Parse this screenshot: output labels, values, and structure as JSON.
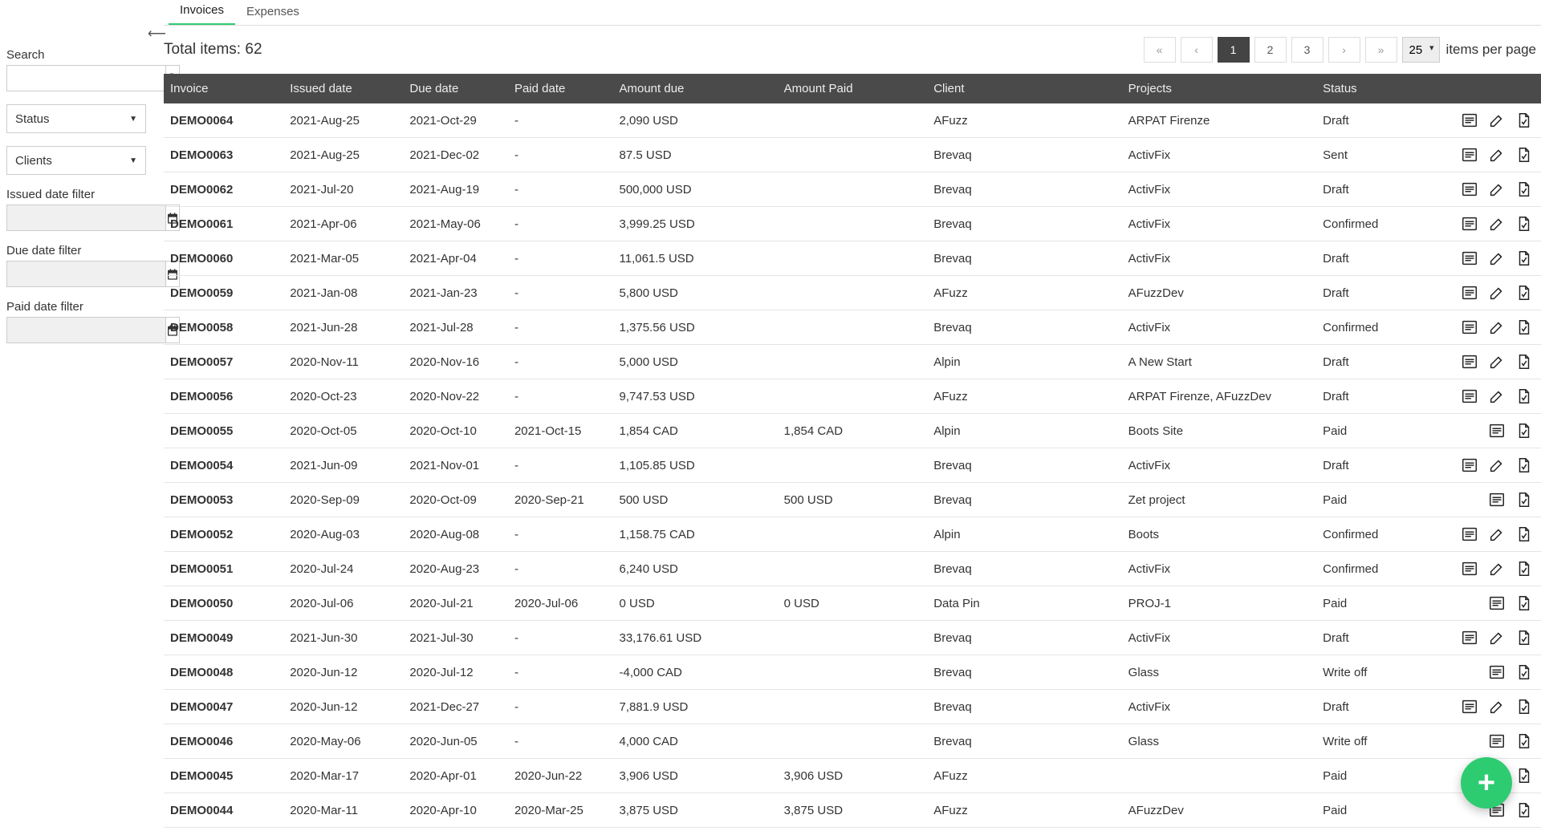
{
  "tabs": {
    "invoices": "Invoices",
    "expenses": "Expenses"
  },
  "sidebar": {
    "search_label": "Search",
    "status_label": "Status",
    "clients_label": "Clients",
    "issued_label": "Issued date filter",
    "due_label": "Due date filter",
    "paid_label": "Paid date filter"
  },
  "summary": {
    "total_prefix": "Total items: ",
    "total_count": "62"
  },
  "pager": {
    "first": "«",
    "prev": "‹",
    "next": "›",
    "last": "»",
    "pages": [
      "1",
      "2",
      "3"
    ],
    "active": "1",
    "per_page_value": "25",
    "per_page_label": "items per page"
  },
  "columns": {
    "invoice": "Invoice",
    "issued": "Issued date",
    "due": "Due date",
    "paid": "Paid date",
    "amount_due": "Amount due",
    "amount_paid": "Amount Paid",
    "client": "Client",
    "projects": "Projects",
    "status": "Status"
  },
  "rows": [
    {
      "inv": "DEMO0064",
      "iss": "2021-Aug-25",
      "due": "2021-Oct-29",
      "paid": "-",
      "adue": "2,090 USD",
      "apaid": "",
      "client": "AFuzz",
      "proj": "ARPAT Firenze",
      "status": "Draft",
      "act": "vep"
    },
    {
      "inv": "DEMO0063",
      "iss": "2021-Aug-25",
      "due": "2021-Dec-02",
      "paid": "-",
      "adue": "87.5 USD",
      "apaid": "",
      "client": "Brevaq",
      "proj": "ActivFix",
      "status": "Sent",
      "act": "vep"
    },
    {
      "inv": "DEMO0062",
      "iss": "2021-Jul-20",
      "due": "2021-Aug-19",
      "paid": "-",
      "adue": "500,000 USD",
      "apaid": "",
      "client": "Brevaq",
      "proj": "ActivFix",
      "status": "Draft",
      "act": "vep"
    },
    {
      "inv": "DEMO0061",
      "iss": "2021-Apr-06",
      "due": "2021-May-06",
      "paid": "-",
      "adue": "3,999.25 USD",
      "apaid": "",
      "client": "Brevaq",
      "proj": "ActivFix",
      "status": "Confirmed",
      "act": "vep"
    },
    {
      "inv": "DEMO0060",
      "iss": "2021-Mar-05",
      "due": "2021-Apr-04",
      "paid": "-",
      "adue": "11,061.5 USD",
      "apaid": "",
      "client": "Brevaq",
      "proj": "ActivFix",
      "status": "Draft",
      "act": "vep"
    },
    {
      "inv": "DEMO0059",
      "iss": "2021-Jan-08",
      "due": "2021-Jan-23",
      "paid": "-",
      "adue": "5,800 USD",
      "apaid": "",
      "client": "AFuzz",
      "proj": "AFuzzDev",
      "status": "Draft",
      "act": "vep"
    },
    {
      "inv": "DEMO0058",
      "iss": "2021-Jun-28",
      "due": "2021-Jul-28",
      "paid": "-",
      "adue": "1,375.56 USD",
      "apaid": "",
      "client": "Brevaq",
      "proj": "ActivFix",
      "status": "Confirmed",
      "act": "vep"
    },
    {
      "inv": "DEMO0057",
      "iss": "2020-Nov-11",
      "due": "2020-Nov-16",
      "paid": "-",
      "adue": "5,000 USD",
      "apaid": "",
      "client": "Alpin",
      "proj": "A New Start",
      "status": "Draft",
      "act": "vep"
    },
    {
      "inv": "DEMO0056",
      "iss": "2020-Oct-23",
      "due": "2020-Nov-22",
      "paid": "-",
      "adue": "9,747.53 USD",
      "apaid": "",
      "client": "AFuzz",
      "proj": "ARPAT Firenze, AFuzzDev",
      "status": "Draft",
      "act": "vep"
    },
    {
      "inv": "DEMO0055",
      "iss": "2020-Oct-05",
      "due": "2020-Oct-10",
      "paid": "2021-Oct-15",
      "adue": "1,854 CAD",
      "apaid": "1,854 CAD",
      "client": "Alpin",
      "proj": "Boots Site",
      "status": "Paid",
      "act": "vp"
    },
    {
      "inv": "DEMO0054",
      "iss": "2021-Jun-09",
      "due": "2021-Nov-01",
      "paid": "-",
      "adue": "1,105.85 USD",
      "apaid": "",
      "client": "Brevaq",
      "proj": "ActivFix",
      "status": "Draft",
      "act": "vep"
    },
    {
      "inv": "DEMO0053",
      "iss": "2020-Sep-09",
      "due": "2020-Oct-09",
      "paid": "2020-Sep-21",
      "adue": "500 USD",
      "apaid": "500 USD",
      "client": "Brevaq",
      "proj": "Zet project",
      "status": "Paid",
      "act": "vp"
    },
    {
      "inv": "DEMO0052",
      "iss": "2020-Aug-03",
      "due": "2020-Aug-08",
      "paid": "-",
      "adue": "1,158.75 CAD",
      "apaid": "",
      "client": "Alpin",
      "proj": "Boots",
      "status": "Confirmed",
      "act": "vep"
    },
    {
      "inv": "DEMO0051",
      "iss": "2020-Jul-24",
      "due": "2020-Aug-23",
      "paid": "-",
      "adue": "6,240 USD",
      "apaid": "",
      "client": "Brevaq",
      "proj": "ActivFix",
      "status": "Confirmed",
      "act": "vep"
    },
    {
      "inv": "DEMO0050",
      "iss": "2020-Jul-06",
      "due": "2020-Jul-21",
      "paid": "2020-Jul-06",
      "adue": "0 USD",
      "apaid": "0 USD",
      "client": "Data Pin",
      "proj": "PROJ-1",
      "status": "Paid",
      "act": "vp"
    },
    {
      "inv": "DEMO0049",
      "iss": "2021-Jun-30",
      "due": "2021-Jul-30",
      "paid": "-",
      "adue": "33,176.61 USD",
      "apaid": "",
      "client": "Brevaq",
      "proj": "ActivFix",
      "status": "Draft",
      "act": "vep"
    },
    {
      "inv": "DEMO0048",
      "iss": "2020-Jun-12",
      "due": "2020-Jul-12",
      "paid": "-",
      "adue": "-4,000 CAD",
      "apaid": "",
      "client": "Brevaq",
      "proj": "Glass",
      "status": "Write off",
      "act": "vp"
    },
    {
      "inv": "DEMO0047",
      "iss": "2020-Jun-12",
      "due": "2021-Dec-27",
      "paid": "-",
      "adue": "7,881.9 USD",
      "apaid": "",
      "client": "Brevaq",
      "proj": "ActivFix",
      "status": "Draft",
      "act": "vep"
    },
    {
      "inv": "DEMO0046",
      "iss": "2020-May-06",
      "due": "2020-Jun-05",
      "paid": "-",
      "adue": "4,000 CAD",
      "apaid": "",
      "client": "Brevaq",
      "proj": "Glass",
      "status": "Write off",
      "act": "vp"
    },
    {
      "inv": "DEMO0045",
      "iss": "2020-Mar-17",
      "due": "2020-Apr-01",
      "paid": "2020-Jun-22",
      "adue": "3,906 USD",
      "apaid": "3,906 USD",
      "client": "AFuzz",
      "proj": "",
      "status": "Paid",
      "act": "vp"
    },
    {
      "inv": "DEMO0044",
      "iss": "2020-Mar-11",
      "due": "2020-Apr-10",
      "paid": "2020-Mar-25",
      "adue": "3,875 USD",
      "apaid": "3,875 USD",
      "client": "AFuzz",
      "proj": "AFuzzDev",
      "status": "Paid",
      "act": "vp"
    }
  ],
  "fab": "+"
}
